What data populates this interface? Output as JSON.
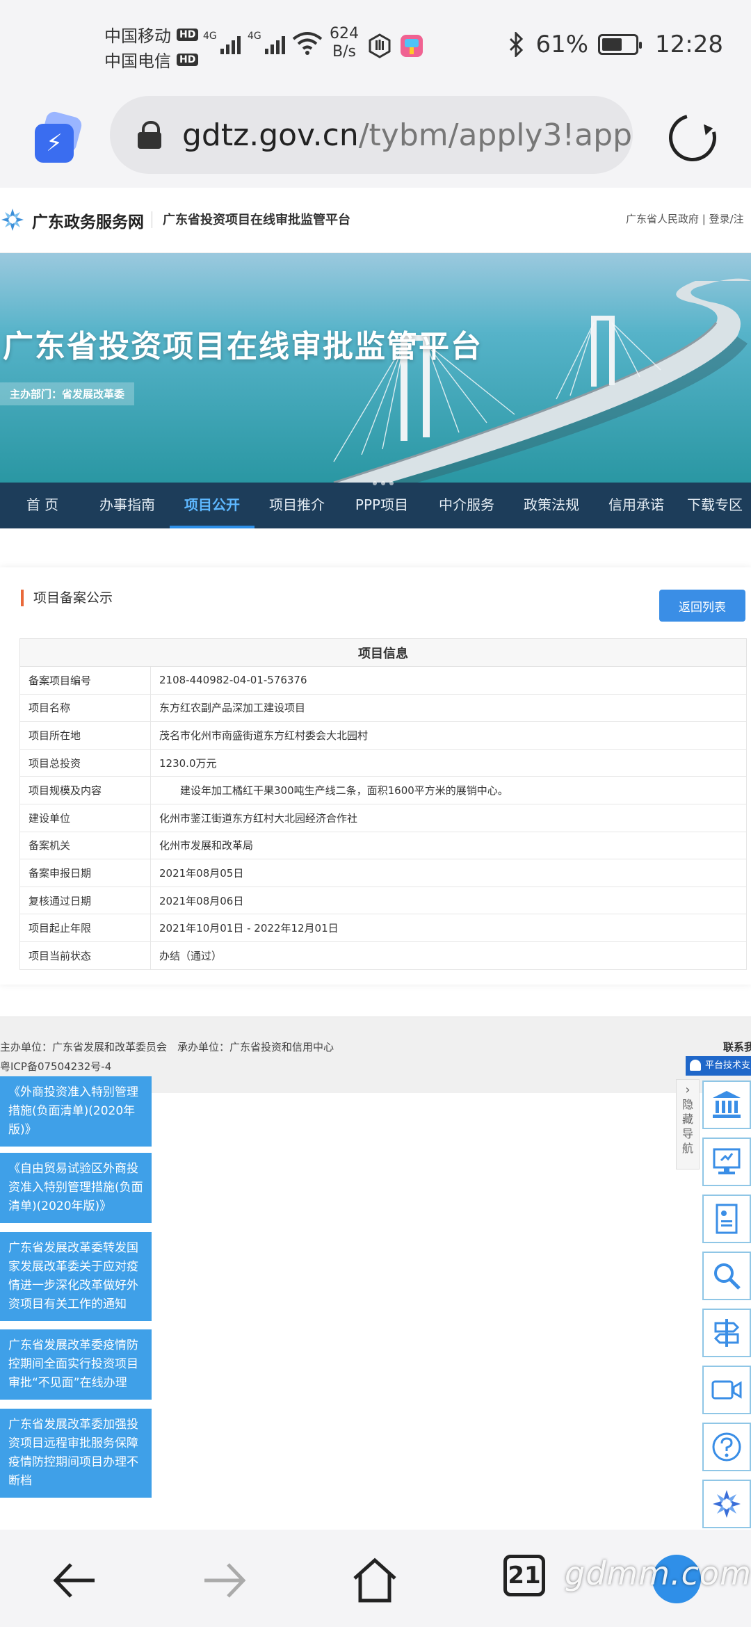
{
  "status_bar": {
    "carrier1": "中国移动",
    "carrier2": "中国电信",
    "hd": "HD",
    "net_type": "4G",
    "speed_value": "624",
    "speed_unit": "B/s",
    "battery": "61%",
    "battery_level": 0.61,
    "time": "12:28"
  },
  "browser": {
    "url_domain": "gdtz.gov.cn",
    "url_path": "/tybm/apply3!app",
    "tab_count": "21"
  },
  "header": {
    "site_name": "广东政务服务网",
    "platform_name": "广东省投资项目在线审批监管平台",
    "right_links": "广东省人民政府 | 登录/注"
  },
  "banner": {
    "title": "广东省投资项目在线审批监管平台",
    "sponsor": "主办部门：省发展改革委"
  },
  "nav": {
    "items": [
      {
        "label": "首 页"
      },
      {
        "label": "办事指南"
      },
      {
        "label": "项目公开"
      },
      {
        "label": "项目推介"
      },
      {
        "label": "PPP项目"
      },
      {
        "label": "中介服务"
      },
      {
        "label": "政策法规"
      },
      {
        "label": "信用承诺"
      },
      {
        "label": "下载专区"
      }
    ],
    "active_index": 2
  },
  "content": {
    "section_title": "项目备案公示",
    "back_button": "返回列表",
    "table_title": "项目信息",
    "rows": [
      {
        "key": "备案项目编号",
        "value": "2108-440982-04-01-576376"
      },
      {
        "key": "项目名称",
        "value": "东方红农副产品深加工建设项目"
      },
      {
        "key": "项目所在地",
        "value": "茂名市化州市南盛街道东方红村委会大北园村"
      },
      {
        "key": "项目总投资",
        "value": "1230.0万元"
      },
      {
        "key": "项目规模及内容",
        "value": "建设年加工橘红干果300吨生产线二条，面积1600平方米的展销中心。"
      },
      {
        "key": "建设单位",
        "value": "化州市鉴江街道东方红村大北园经济合作社"
      },
      {
        "key": "备案机关",
        "value": "化州市发展和改革局"
      },
      {
        "key": "备案申报日期",
        "value": "2021年08月05日"
      },
      {
        "key": "复核通过日期",
        "value": "2021年08月06日"
      },
      {
        "key": "项目起止年限",
        "value": "2021年10月01日 - 2022年12月01日"
      },
      {
        "key": "项目当前状态",
        "value": "办结（通过）"
      }
    ]
  },
  "footer": {
    "line1": "主办单位：广东省发展和改革委员会　承办单位：广东省投资和信用中心",
    "line2": "粤ICP备07504232号-4",
    "contact": "联系我",
    "support": "平台技术支"
  },
  "notices": [
    {
      "text": "《外商投资准入特别管理措施(负面清单)(2020年版)》"
    },
    {
      "text": "《自由贸易试验区外商投资准入特别管理措施(负面清单)(2020年版)》"
    },
    {
      "text": "广东省发展改革委转发国家发展改革委关于应对疫情进一步深化改革做好外资项目有关工作的通知"
    },
    {
      "text": "广东省发展改革委疫情防控期间全面实行投资项目审批“不见面”在线办理"
    },
    {
      "text": "广东省发展改革委加强投资项目远程审批服务保障疫情防控期间项目办理不断档"
    }
  ],
  "side_nav": {
    "toggle_label": "隐藏导航",
    "icons": [
      "bank-icon",
      "monitor-icon",
      "document-icon",
      "search-icon",
      "signpost-icon",
      "video-icon",
      "help-icon",
      "logo-icon"
    ]
  },
  "watermark": "gdmm.com",
  "colors": {
    "accent_blue": "#3a8ee6",
    "nav_bg": "#1d3d5a",
    "nav_active": "#5eb8ff",
    "section_marker": "#e9693a",
    "notice_bg": "#3fa0e8"
  }
}
